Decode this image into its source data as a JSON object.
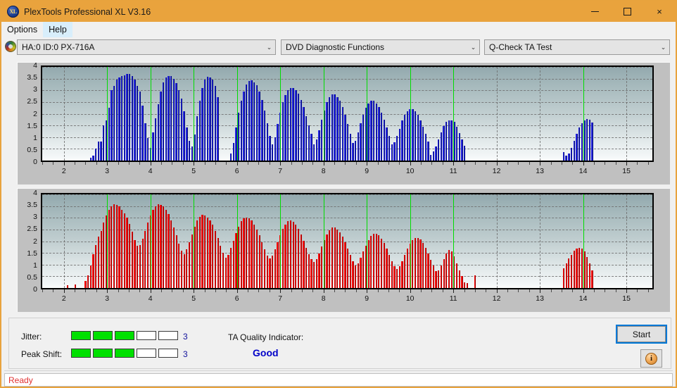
{
  "window": {
    "title": "PlexTools Professional XL V3.16",
    "app_icon": "XL",
    "minimize": "—",
    "maximize": "□",
    "close": "×",
    "titlebar_color": "#e9a33d"
  },
  "menubar": {
    "items": [
      {
        "label": "Options",
        "active": false
      },
      {
        "label": "Help",
        "active": true
      }
    ]
  },
  "toolbar": {
    "drive_select": {
      "value": "HA:0 ID:0  PX-716A",
      "arrow": "⌄"
    },
    "function_select": {
      "value": "DVD Diagnostic Functions",
      "arrow": "⌄"
    },
    "test_select": {
      "value": "Q-Check TA Test",
      "arrow": "⌄"
    }
  },
  "chart_data": [
    {
      "type": "bar",
      "title": "Jitter TA Test (upper plot)",
      "series_name": "Jitter",
      "color": "#2222dd",
      "xlabel": "",
      "ylabel": "",
      "xlim": [
        1.5,
        15.6
      ],
      "ylim": [
        0,
        4
      ],
      "yticks": [
        0,
        0.5,
        1,
        1.5,
        2,
        2.5,
        3,
        3.5,
        4
      ],
      "xticks": [
        2,
        3,
        4,
        5,
        6,
        7,
        8,
        9,
        10,
        11,
        12,
        13,
        14,
        15
      ],
      "grid": true,
      "markers_x": [
        3,
        4,
        5,
        6,
        7,
        8,
        9,
        10,
        11,
        14
      ],
      "marker_color": "#00dd00",
      "x": [
        2.62,
        2.68,
        2.74,
        2.8,
        2.86,
        2.92,
        2.98,
        3.04,
        3.1,
        3.16,
        3.22,
        3.28,
        3.34,
        3.4,
        3.46,
        3.52,
        3.58,
        3.64,
        3.7,
        3.76,
        3.82,
        3.88,
        3.94,
        4.0,
        4.06,
        4.12,
        4.18,
        4.24,
        4.3,
        4.36,
        4.42,
        4.48,
        4.54,
        4.6,
        4.66,
        4.72,
        4.78,
        4.84,
        4.9,
        4.96,
        5.02,
        5.08,
        5.14,
        5.2,
        5.26,
        5.32,
        5.38,
        5.44,
        5.5,
        5.56,
        5.86,
        5.92,
        5.98,
        6.04,
        6.1,
        6.16,
        6.22,
        6.28,
        6.34,
        6.4,
        6.46,
        6.52,
        6.58,
        6.64,
        6.7,
        6.76,
        6.82,
        6.88,
        6.94,
        7.0,
        7.06,
        7.12,
        7.18,
        7.24,
        7.3,
        7.36,
        7.42,
        7.48,
        7.54,
        7.6,
        7.66,
        7.72,
        7.78,
        7.84,
        7.9,
        7.96,
        8.02,
        8.08,
        8.14,
        8.2,
        8.26,
        8.32,
        8.38,
        8.44,
        8.5,
        8.56,
        8.62,
        8.68,
        8.74,
        8.8,
        8.86,
        8.92,
        8.98,
        9.04,
        9.1,
        9.16,
        9.22,
        9.28,
        9.34,
        9.4,
        9.46,
        9.52,
        9.58,
        9.64,
        9.7,
        9.76,
        9.82,
        9.88,
        9.94,
        10.0,
        10.06,
        10.12,
        10.18,
        10.24,
        10.3,
        10.36,
        10.42,
        10.48,
        10.54,
        10.6,
        10.66,
        10.72,
        10.78,
        10.84,
        10.9,
        10.96,
        11.02,
        11.08,
        11.14,
        11.2,
        11.26,
        13.55,
        13.61,
        13.67,
        13.73,
        13.79,
        13.85,
        13.91,
        13.97,
        14.03,
        14.09,
        14.15,
        14.21
      ],
      "values": [
        0.12,
        0.2,
        0.5,
        0.8,
        0.82,
        1.5,
        1.7,
        2.25,
        3.0,
        3.2,
        3.45,
        3.55,
        3.6,
        3.65,
        3.7,
        3.7,
        3.6,
        3.45,
        3.2,
        2.95,
        2.35,
        1.6,
        0.95,
        0.55,
        1.2,
        1.8,
        2.4,
        2.95,
        3.35,
        3.55,
        3.62,
        3.62,
        3.5,
        3.3,
        3.0,
        2.65,
        2.1,
        1.4,
        0.85,
        0.6,
        1.1,
        1.9,
        2.55,
        3.1,
        3.45,
        3.58,
        3.55,
        3.45,
        3.2,
        2.7,
        0.3,
        0.75,
        1.4,
        2.05,
        2.55,
        2.95,
        3.25,
        3.4,
        3.42,
        3.35,
        3.22,
        2.95,
        2.6,
        2.15,
        1.6,
        1.05,
        0.7,
        1.0,
        1.55,
        2.05,
        2.5,
        2.8,
        3.0,
        3.1,
        3.1,
        3.0,
        2.85,
        2.6,
        2.3,
        1.9,
        1.5,
        1.15,
        0.7,
        0.9,
        1.3,
        1.75,
        2.15,
        2.5,
        2.72,
        2.82,
        2.82,
        2.72,
        2.55,
        2.3,
        1.95,
        1.55,
        1.15,
        0.75,
        0.85,
        1.2,
        1.6,
        1.95,
        2.25,
        2.45,
        2.55,
        2.55,
        2.45,
        2.3,
        2.05,
        1.75,
        1.4,
        1.05,
        0.7,
        0.78,
        1.05,
        1.35,
        1.7,
        1.95,
        2.12,
        2.2,
        2.2,
        2.1,
        1.95,
        1.72,
        1.45,
        1.15,
        0.82,
        0.25,
        0.38,
        0.6,
        0.9,
        1.2,
        1.48,
        1.65,
        1.72,
        1.72,
        1.65,
        1.45,
        1.18,
        0.9,
        0.62,
        0.35,
        0.2,
        0.3,
        0.55,
        0.85,
        1.15,
        1.42,
        1.6,
        1.72,
        1.78,
        1.75,
        1.62,
        1.42,
        1.15,
        0.85,
        0.55
      ],
      "bar_border_color": "#000a7a"
    },
    {
      "type": "bar",
      "title": "Peak Shift TA Test (lower plot)",
      "series_name": "Peak Shift",
      "color": "#fa0a0a",
      "xlabel": "",
      "ylabel": "",
      "xlim": [
        1.5,
        15.6
      ],
      "ylim": [
        0,
        4
      ],
      "yticks": [
        0,
        0.5,
        1,
        1.5,
        2,
        2.5,
        3,
        3.5,
        4
      ],
      "xticks": [
        2,
        3,
        4,
        5,
        6,
        7,
        8,
        9,
        10,
        11,
        12,
        13,
        14,
        15
      ],
      "grid": true,
      "markers_x": [
        3,
        4,
        5,
        6,
        7,
        8,
        9,
        10,
        11,
        14
      ],
      "marker_color": "#00dd00",
      "x": [
        2.08,
        2.26,
        2.5,
        2.56,
        2.62,
        2.68,
        2.74,
        2.8,
        2.86,
        2.92,
        2.98,
        3.04,
        3.1,
        3.16,
        3.22,
        3.28,
        3.34,
        3.4,
        3.46,
        3.52,
        3.58,
        3.64,
        3.7,
        3.76,
        3.82,
        3.88,
        3.94,
        4.0,
        4.06,
        4.12,
        4.18,
        4.24,
        4.3,
        4.36,
        4.42,
        4.48,
        4.54,
        4.6,
        4.66,
        4.72,
        4.78,
        4.84,
        4.9,
        4.96,
        5.02,
        5.08,
        5.14,
        5.2,
        5.26,
        5.32,
        5.38,
        5.44,
        5.5,
        5.56,
        5.62,
        5.68,
        5.74,
        5.8,
        5.86,
        5.92,
        5.98,
        6.04,
        6.1,
        6.16,
        6.22,
        6.28,
        6.34,
        6.4,
        6.46,
        6.52,
        6.58,
        6.64,
        6.7,
        6.76,
        6.82,
        6.88,
        6.94,
        7.0,
        7.06,
        7.12,
        7.18,
        7.24,
        7.3,
        7.36,
        7.42,
        7.48,
        7.54,
        7.6,
        7.66,
        7.72,
        7.78,
        7.84,
        7.9,
        7.96,
        8.02,
        8.08,
        8.14,
        8.2,
        8.26,
        8.32,
        8.38,
        8.44,
        8.5,
        8.56,
        8.62,
        8.68,
        8.74,
        8.8,
        8.86,
        8.92,
        8.98,
        9.04,
        9.1,
        9.16,
        9.22,
        9.28,
        9.34,
        9.4,
        9.46,
        9.52,
        9.58,
        9.64,
        9.7,
        9.76,
        9.82,
        9.88,
        9.94,
        10.0,
        10.06,
        10.12,
        10.18,
        10.24,
        10.3,
        10.36,
        10.42,
        10.48,
        10.54,
        10.6,
        10.66,
        10.72,
        10.78,
        10.84,
        10.9,
        10.96,
        11.02,
        11.08,
        11.14,
        11.2,
        11.26,
        11.32,
        11.5,
        13.55,
        13.61,
        13.67,
        13.73,
        13.79,
        13.85,
        13.91,
        13.97,
        14.03,
        14.09,
        14.15,
        14.21,
        14.27
      ],
      "values": [
        0.12,
        0.14,
        0.3,
        0.55,
        0.95,
        1.45,
        1.85,
        2.2,
        2.45,
        2.8,
        3.1,
        3.35,
        3.5,
        3.58,
        3.55,
        3.48,
        3.35,
        3.2,
        3.0,
        2.75,
        2.4,
        2.05,
        1.8,
        1.85,
        2.1,
        2.45,
        2.8,
        3.1,
        3.35,
        3.5,
        3.58,
        3.55,
        3.48,
        3.35,
        3.15,
        2.9,
        2.6,
        2.25,
        1.9,
        1.6,
        1.45,
        1.65,
        1.95,
        2.3,
        2.62,
        2.88,
        3.05,
        3.12,
        3.1,
        3.0,
        2.88,
        2.7,
        2.45,
        2.15,
        1.8,
        1.5,
        1.3,
        1.42,
        1.7,
        2.02,
        2.35,
        2.62,
        2.85,
        2.98,
        3.02,
        2.98,
        2.88,
        2.72,
        2.5,
        2.25,
        1.95,
        1.65,
        1.38,
        1.25,
        1.38,
        1.65,
        1.95,
        2.25,
        2.52,
        2.72,
        2.85,
        2.88,
        2.82,
        2.7,
        2.52,
        2.3,
        2.02,
        1.72,
        1.45,
        1.22,
        1.1,
        1.22,
        1.48,
        1.78,
        2.05,
        2.3,
        2.48,
        2.58,
        2.58,
        2.5,
        2.38,
        2.2,
        1.95,
        1.68,
        1.4,
        1.15,
        0.95,
        1.05,
        1.28,
        1.55,
        1.82,
        2.05,
        2.22,
        2.32,
        2.32,
        2.25,
        2.12,
        1.92,
        1.68,
        1.42,
        1.15,
        0.92,
        0.8,
        0.92,
        1.15,
        1.42,
        1.68,
        1.9,
        2.05,
        2.15,
        2.15,
        2.08,
        1.92,
        1.72,
        1.48,
        1.2,
        0.95,
        0.72,
        0.75,
        0.95,
        1.22,
        1.48,
        1.62,
        1.55,
        1.35,
        1.05,
        0.75,
        0.5,
        0.25,
        0.22,
        0.55,
        0.85,
        1.05,
        1.25,
        1.42,
        1.58,
        1.68,
        1.72,
        1.68,
        1.55,
        1.32,
        1.05,
        0.75
      ],
      "bar_border_color": "#9a0000"
    }
  ],
  "bottom": {
    "jitter_label": "Jitter:",
    "jitter_value": "3",
    "jitter_filled": 3,
    "jitter_total": 5,
    "peak_shift_label": "Peak Shift:",
    "peak_shift_value": "3",
    "peak_shift_filled": 3,
    "peak_shift_total": 5,
    "ta_quality_label": "TA Quality Indicator:",
    "ta_quality_value": "Good",
    "ta_quality_color": "#0000c8",
    "meter_on_color": "#00e000",
    "start_label": "Start",
    "info_glyph": "i"
  },
  "statusbar": {
    "text": "Ready",
    "color": "#e03030"
  }
}
